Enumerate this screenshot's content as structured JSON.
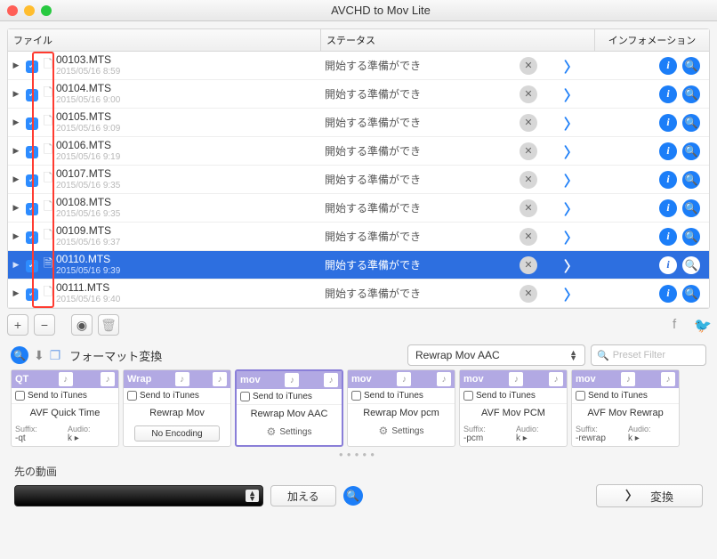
{
  "window": {
    "title": "AVCHD to Mov Lite"
  },
  "columns": {
    "file": "ファイル",
    "status": "ステータス",
    "info": "インフォメーション"
  },
  "status_text": "開始する準備ができ",
  "files": [
    {
      "name": "00103.MTS",
      "date": "2015/05/16 8:59",
      "selected": false,
      "special_icon": false
    },
    {
      "name": "00104.MTS",
      "date": "2015/05/16 9:00",
      "selected": false,
      "special_icon": false
    },
    {
      "name": "00105.MTS",
      "date": "2015/05/16 9:09",
      "selected": false,
      "special_icon": false
    },
    {
      "name": "00106.MTS",
      "date": "2015/05/16 9:19",
      "selected": false,
      "special_icon": false
    },
    {
      "name": "00107.MTS",
      "date": "2015/05/16 9:35",
      "selected": false,
      "special_icon": false
    },
    {
      "name": "00108.MTS",
      "date": "2015/05/16 9:35",
      "selected": false,
      "special_icon": false
    },
    {
      "name": "00109.MTS",
      "date": "2015/05/16 9:37",
      "selected": false,
      "special_icon": false
    },
    {
      "name": "00110.MTS",
      "date": "2015/05/16 9:39",
      "selected": true,
      "special_icon": true
    },
    {
      "name": "00111.MTS",
      "date": "2015/05/16 9:40",
      "selected": false,
      "special_icon": false
    }
  ],
  "format_section": {
    "label": "フォーマット変換",
    "dropdown_value": "Rewrap Mov AAC",
    "filter_placeholder": "Preset Filter"
  },
  "send_to_itunes_label": "Send to iTunes",
  "presets": [
    {
      "badge": "QT",
      "extra_icon": true,
      "name": "AVF Quick Time",
      "mode": "suffix_audio",
      "suffix": "-qt",
      "audio": "k",
      "active": false
    },
    {
      "badge": "Wrap",
      "extra_icon": false,
      "name": "Rewrap Mov",
      "mode": "noenc",
      "noenc": "No Encoding",
      "active": false
    },
    {
      "badge": "mov",
      "extra_icon": false,
      "name": "Rewrap Mov AAC",
      "mode": "settings",
      "settings": "Settings",
      "active": true
    },
    {
      "badge": "mov",
      "extra_icon": false,
      "name": "Rewrap Mov pcm",
      "mode": "settings",
      "settings": "Settings",
      "active": false
    },
    {
      "badge": "mov",
      "extra_icon": false,
      "name": "AVF Mov PCM",
      "mode": "suffix_audio",
      "suffix": "-pcm",
      "audio": "k",
      "active": false
    },
    {
      "badge": "mov",
      "extra_icon": false,
      "name": "AVF Mov Rewrap",
      "mode": "suffix_audio",
      "suffix": "-rewrap",
      "audio": "k",
      "active": false
    }
  ],
  "labels": {
    "suffix": "Suffix:",
    "audio": "Audio:"
  },
  "dest": {
    "label": "先の動画",
    "add": "加える",
    "convert": "変換"
  }
}
